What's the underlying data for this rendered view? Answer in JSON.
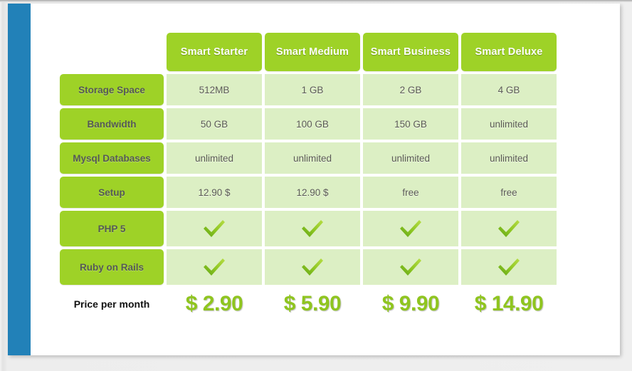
{
  "theme": {
    "accent_green": "#9ed227",
    "cell_green": "#dcefc4",
    "sidebar_blue": "#2281b8",
    "price_green": "#8fc51f",
    "label_text": "#555a55",
    "value_text": "#5b5b55"
  },
  "table": {
    "corner_label": "",
    "plans": [
      {
        "name": "Smart Starter"
      },
      {
        "name": "Smart Medium"
      },
      {
        "name": "Smart Business"
      },
      {
        "name": "Smart Deluxe"
      }
    ],
    "rows": [
      {
        "label": "Storage Space",
        "type": "text",
        "values": [
          "512MB",
          "1 GB",
          "2 GB",
          "4 GB"
        ]
      },
      {
        "label": "Bandwidth",
        "type": "text",
        "values": [
          "50 GB",
          "100 GB",
          "150 GB",
          "unlimited"
        ]
      },
      {
        "label": "Mysql Databases",
        "type": "text",
        "values": [
          "unlimited",
          "unlimited",
          "unlimited",
          "unlimited"
        ]
      },
      {
        "label": "Setup",
        "type": "text",
        "values": [
          "12.90 $",
          "12.90 $",
          "free",
          "free"
        ]
      },
      {
        "label": "PHP 5",
        "type": "check",
        "values": [
          "check-icon",
          "check-icon",
          "check-icon",
          "check-icon"
        ]
      },
      {
        "label": "Ruby on Rails",
        "type": "check",
        "values": [
          "check-icon",
          "check-icon",
          "check-icon",
          "check-icon"
        ]
      }
    ],
    "price_row": {
      "label": "Price per month",
      "values": [
        "$ 2.90",
        "$ 5.90",
        "$ 9.90",
        "$ 14.90"
      ]
    }
  }
}
